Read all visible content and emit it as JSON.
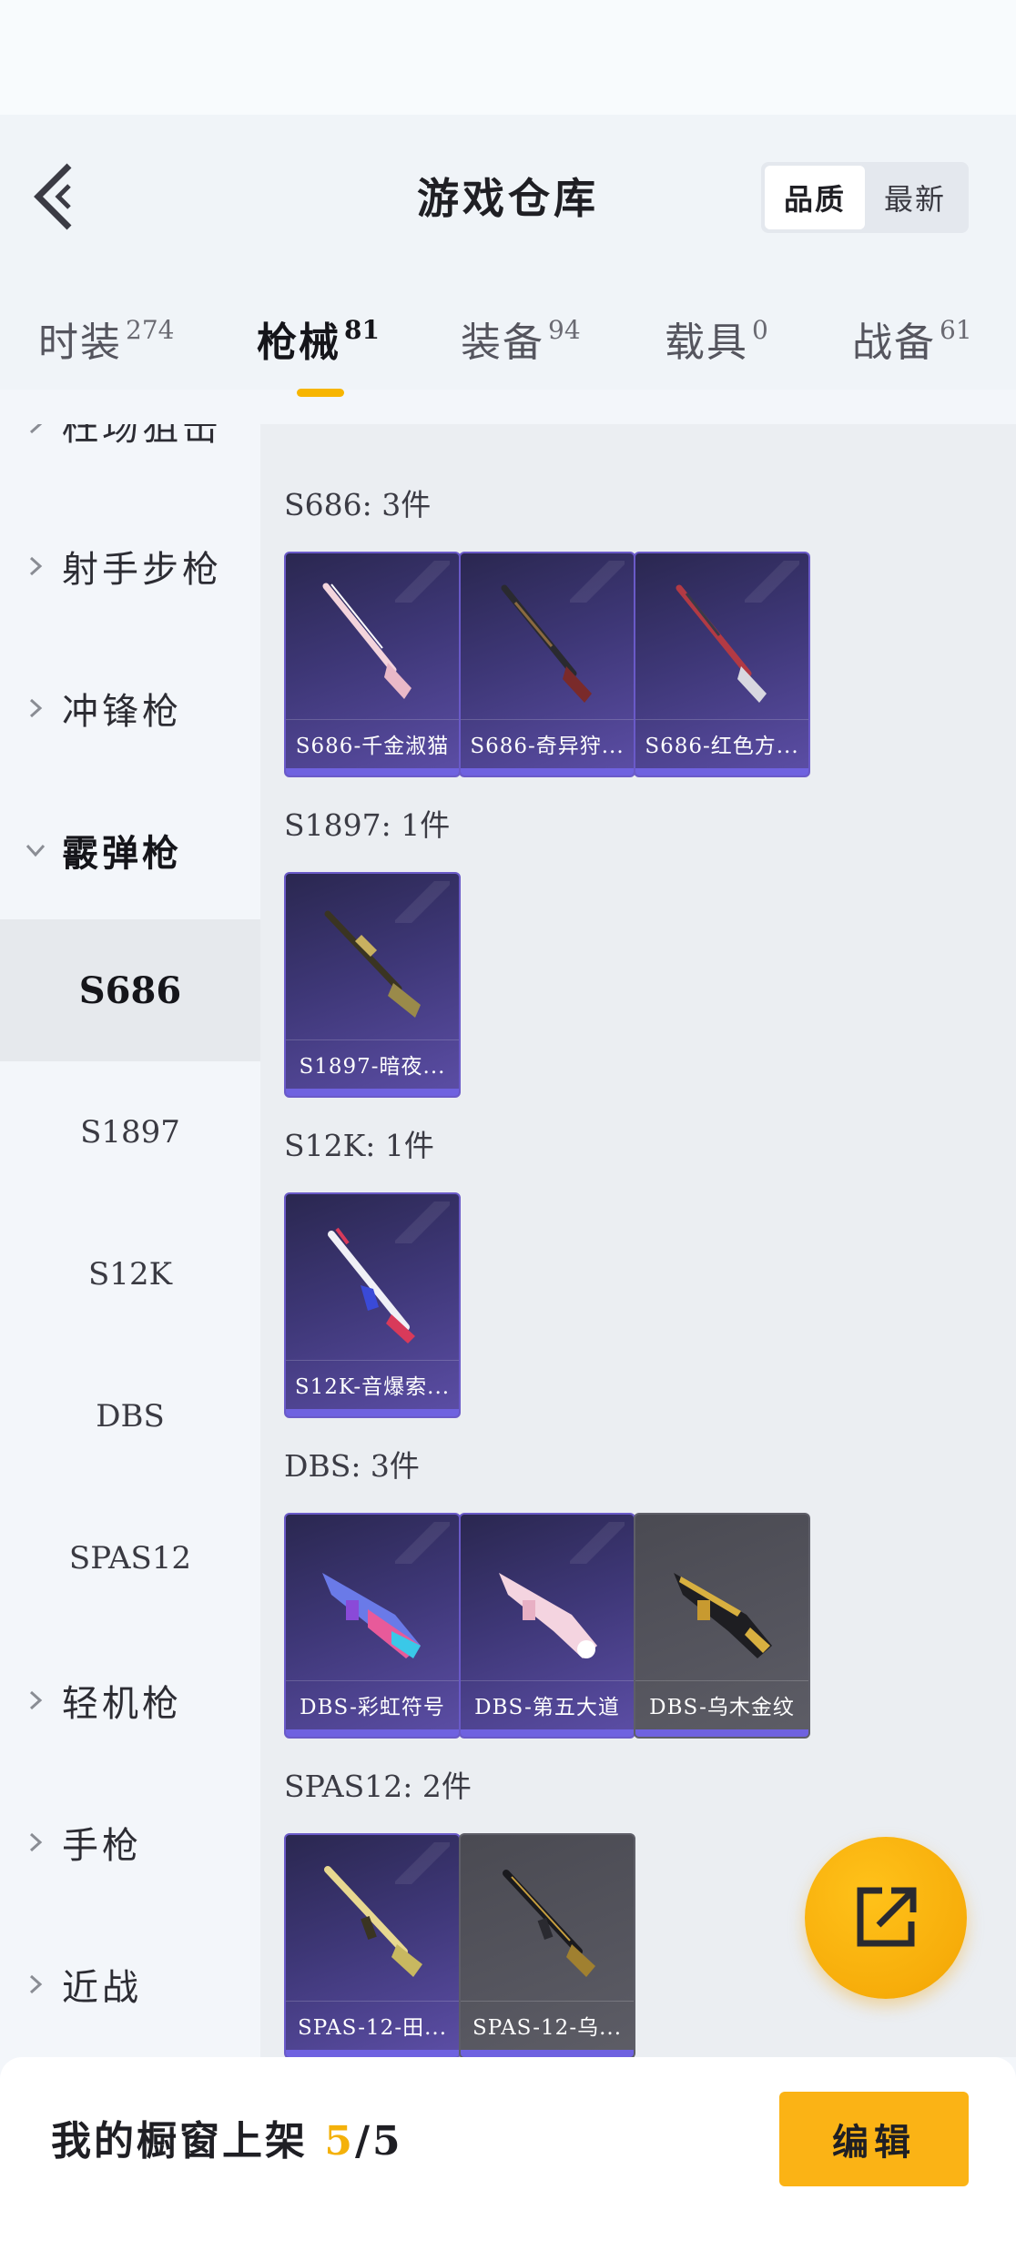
{
  "header": {
    "title": "游戏仓库",
    "sort_options": [
      {
        "label": "品质",
        "active": true
      },
      {
        "label": "最新",
        "active": false
      }
    ]
  },
  "tabs": [
    {
      "label": "时装",
      "count": "274",
      "active": false
    },
    {
      "label": "枪械",
      "count": "81",
      "active": true
    },
    {
      "label": "装备",
      "count": "94",
      "active": false
    },
    {
      "label": "载具",
      "count": "0",
      "active": false
    },
    {
      "label": "战备",
      "count": "61",
      "active": false
    }
  ],
  "sidebar": {
    "partial_top_label": "枉场狙击",
    "categories": [
      {
        "label": "射手步枪",
        "expanded": false
      },
      {
        "label": "冲锋枪",
        "expanded": false
      },
      {
        "label": "霰弹枪",
        "expanded": true
      },
      {
        "label": "轻机枪",
        "expanded": false
      },
      {
        "label": "手枪",
        "expanded": false
      },
      {
        "label": "近战",
        "expanded": false
      }
    ],
    "sub_items": [
      {
        "label": "S686",
        "active": true
      },
      {
        "label": "S1897",
        "active": false
      },
      {
        "label": "S12K",
        "active": false
      },
      {
        "label": "DBS",
        "active": false
      },
      {
        "label": "SPAS12",
        "active": false
      }
    ]
  },
  "groups": [
    {
      "title": "S686: 3件",
      "items": [
        {
          "name": "S686-千金淑猫",
          "icon": "shotgun-pink-icon",
          "tone": "purple"
        },
        {
          "name": "S686-奇异狩...",
          "icon": "shotgun-dark-icon",
          "tone": "purple"
        },
        {
          "name": "S686-红色方...",
          "icon": "shotgun-red-icon",
          "tone": "purple"
        }
      ]
    },
    {
      "title": "S1897: 1件",
      "items": [
        {
          "name": "S1897-暗夜...",
          "icon": "pump-shotgun-gold-icon",
          "tone": "purple"
        }
      ]
    },
    {
      "title": "S12K: 1件",
      "items": [
        {
          "name": "S12K-音爆索...",
          "icon": "auto-shotgun-white-icon",
          "tone": "purple"
        }
      ]
    },
    {
      "title": "DBS: 3件",
      "items": [
        {
          "name": "DBS-彩虹符号",
          "icon": "bullpup-rainbow-icon",
          "tone": "purple"
        },
        {
          "name": "DBS-第五大道",
          "icon": "bullpup-pink-icon",
          "tone": "purple"
        },
        {
          "name": "DBS-乌木金纹",
          "icon": "bullpup-gold-icon",
          "tone": "gray"
        }
      ]
    },
    {
      "title": "SPAS12: 2件",
      "items": [
        {
          "name": "SPAS-12-田...",
          "icon": "spas-gold-icon",
          "tone": "purple"
        },
        {
          "name": "SPAS-12-乌...",
          "icon": "spas-ebony-icon",
          "tone": "gray"
        }
      ]
    }
  ],
  "fab": {
    "icon": "share-out-icon"
  },
  "bottom": {
    "showcase_label": "我的橱窗上架",
    "showcase_current": "5",
    "showcase_separator": "/",
    "showcase_total": "5",
    "edit_label": "编辑"
  },
  "colors": {
    "accent": "#f7b500",
    "card_purple": "#3e3777",
    "card_gray": "#55555e",
    "card_bar": "#6f62e0"
  }
}
